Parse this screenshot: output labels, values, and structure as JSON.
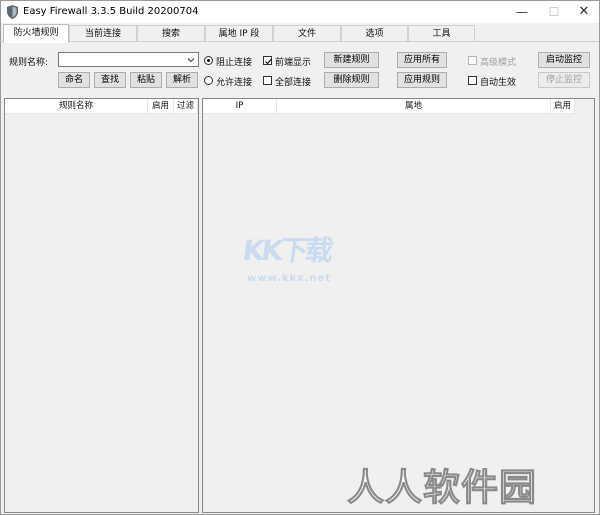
{
  "window": {
    "title": "Easy Firewall 3.3.5 Build 20200704",
    "minimize": "—",
    "maximize": "☐",
    "close": "✕"
  },
  "tabs": [
    {
      "label": "防火墙规则",
      "active": true
    },
    {
      "label": "当前连接",
      "active": false
    },
    {
      "label": "搜索",
      "active": false
    },
    {
      "label": "属地 IP 段",
      "active": false
    },
    {
      "label": "文件",
      "active": false
    },
    {
      "label": "选项",
      "active": false
    },
    {
      "label": "工具",
      "active": false
    }
  ],
  "toolbar": {
    "rule_name_label": "规则名称:",
    "rule_name_value": "",
    "buttons_row1": {
      "rename": "命名",
      "find": "查找",
      "paste": "粘贴",
      "parse": "解析"
    },
    "radio_block": {
      "label": "阻止连接",
      "selected": true
    },
    "radio_allow": {
      "label": "允许连接",
      "selected": false
    },
    "check_front": {
      "label": "前端显示",
      "checked": true
    },
    "check_all_conn": {
      "label": "全部连接",
      "checked": false
    },
    "new_rule": "新建规则",
    "delete_rule": "删除规则",
    "apply_all": "应用所有",
    "apply_rule": "应用规则",
    "advanced_mode": {
      "label": "高级模式",
      "checked": false,
      "disabled": true
    },
    "auto_apply": {
      "label": "自动生效",
      "checked": false
    },
    "start_monitor": "启动监控",
    "stop_monitor": {
      "label": "停止监控",
      "disabled": true
    }
  },
  "left_table": {
    "headers": [
      "规则名称",
      "启用",
      "过滤"
    ],
    "rows": []
  },
  "right_table": {
    "headers": [
      "IP",
      "属地",
      "启用"
    ],
    "rows": []
  },
  "watermarks": {
    "logo": "KK下载",
    "url": "www.kkx.net",
    "site": "人人软件园"
  },
  "colors": {
    "window_bg": "#f0f0f0",
    "button_bg": "#e1e1e1",
    "disabled_text": "#a0a0a0",
    "watermark_blue": "#c9dcef"
  }
}
